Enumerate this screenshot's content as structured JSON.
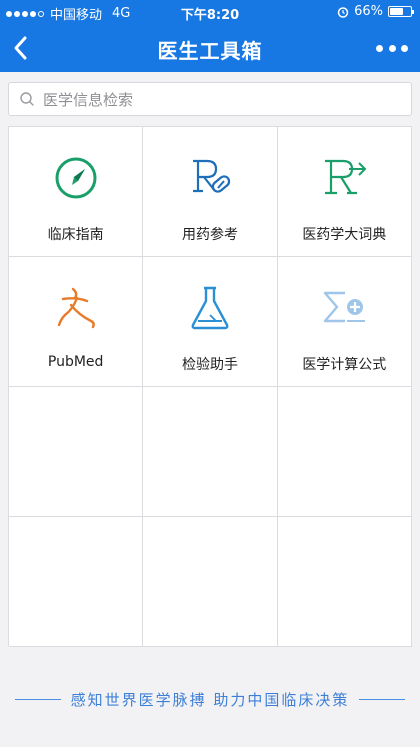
{
  "status": {
    "carrier": "中国移动",
    "network": "4G",
    "time": "下午8:20",
    "battery": "66%",
    "battery_level": 0.66
  },
  "nav": {
    "title": "医生工具箱",
    "back_icon": "chevron-left-icon",
    "more_icon": "more-dots-icon"
  },
  "search": {
    "placeholder": "医学信息检索",
    "icon": "search-icon"
  },
  "tools": [
    {
      "label": "临床指南",
      "icon": "compass-icon",
      "color": "#1a9e6a"
    },
    {
      "label": "用药参考",
      "icon": "rx-icon",
      "color": "#1c6fb8"
    },
    {
      "label": "医药学大词典",
      "icon": "dictionary-r-icon",
      "color": "#1a9e6a"
    },
    {
      "label": "PubMed",
      "icon": "pubmed-icon",
      "color": "#e87b2a"
    },
    {
      "label": "检验助手",
      "icon": "flask-icon",
      "color": "#2b8fd6"
    },
    {
      "label": "医学计算公式",
      "icon": "sigma-plus-icon",
      "color": "#9fc6e8"
    }
  ],
  "footer": {
    "text": "感知世界医学脉搏  助力中国临床决策"
  },
  "colors": {
    "brand": "#1777e3",
    "footer_text": "#3d7fd8"
  }
}
